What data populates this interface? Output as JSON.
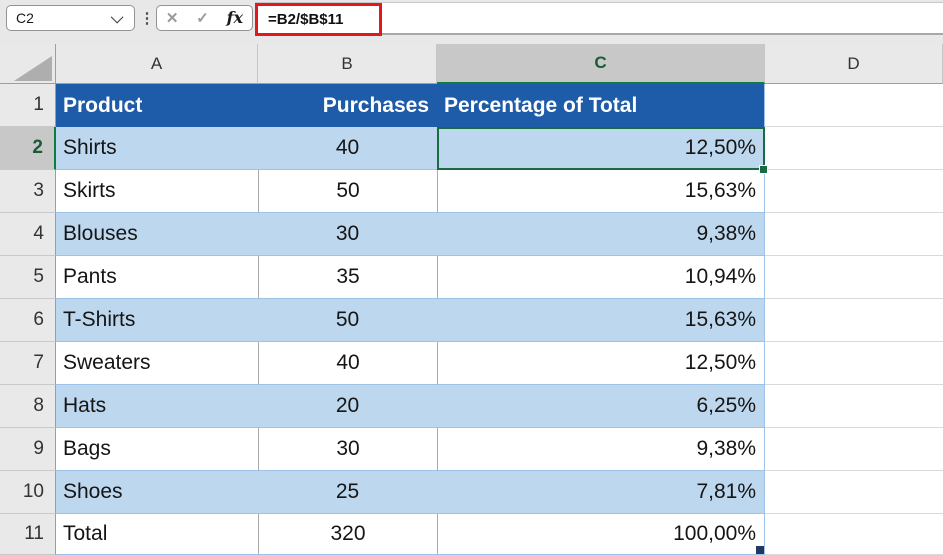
{
  "name_box": {
    "value": "C2"
  },
  "formula_bar": {
    "formula": "=B2/$B$11",
    "cancel": "✕",
    "enter": "✓",
    "fx": "fx",
    "more": "⋮"
  },
  "grid": {
    "column_letters": [
      "A",
      "B",
      "C",
      "D"
    ],
    "selected_column": "C",
    "row_numbers": [
      "1",
      "2",
      "3",
      "4",
      "5",
      "6",
      "7",
      "8",
      "9",
      "10",
      "11"
    ],
    "selected_row": "2"
  },
  "table": {
    "headers": {
      "product": "Product",
      "purchases": "Purchases",
      "pct": "Percentage of Total"
    },
    "rows": [
      {
        "product": "Shirts",
        "purchases": "40",
        "pct": "12,50%"
      },
      {
        "product": "Skirts",
        "purchases": "50",
        "pct": "15,63%"
      },
      {
        "product": "Blouses",
        "purchases": "30",
        "pct": "9,38%"
      },
      {
        "product": "Pants",
        "purchases": "35",
        "pct": "10,94%"
      },
      {
        "product": "T-Shirts",
        "purchases": "50",
        "pct": "15,63%"
      },
      {
        "product": "Sweaters",
        "purchases": "40",
        "pct": "12,50%"
      },
      {
        "product": "Hats",
        "purchases": "20",
        "pct": "6,25%"
      },
      {
        "product": "Bags",
        "purchases": "30",
        "pct": "9,38%"
      },
      {
        "product": "Shoes",
        "purchases": "25",
        "pct": "7,81%"
      },
      {
        "product": "Total",
        "purchases": "320",
        "pct": "100,00%"
      }
    ]
  },
  "selection": {
    "cell": "C2"
  },
  "colors": {
    "table_header_bg": "#1e5ba9",
    "band_bg": "#bdd7ee",
    "selection_border": "#1a6b44",
    "highlight_border": "#e0191e",
    "selected_header_text": "#185c37",
    "header_accent_green": "#107c41",
    "table_corner_handle": "#1f3864",
    "table_border": "#9dc3e6"
  }
}
